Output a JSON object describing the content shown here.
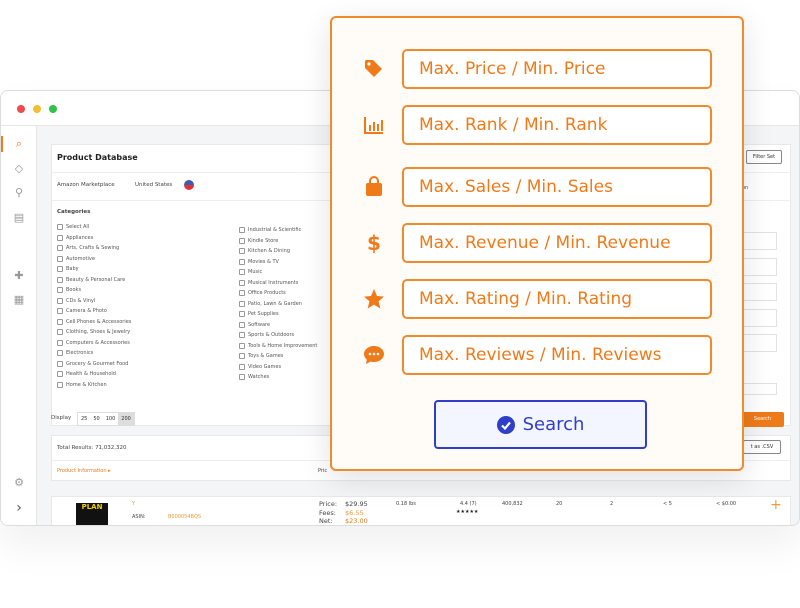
{
  "app": {
    "title": "Product Database",
    "marketplace_label": "Amazon Marketplace",
    "marketplace_value": "United States",
    "categories_label": "Categories",
    "save_filter": "Filter Set",
    "display_label": "Display",
    "display_options": [
      "25",
      "50",
      "100",
      "200"
    ],
    "total_results_label": "Total Results:",
    "total_results": "71,032,320",
    "col_product_info": "Product Information",
    "col_price": "Pric",
    "export": "t as .CSV",
    "search_small": "Search",
    "right_label": "on"
  },
  "categories_col1": [
    "Select All",
    "Appliances",
    "Arts, Crafts & Sewing",
    "Automotive",
    "Baby",
    "Beauty & Personal Care",
    "Books",
    "CDs & Vinyl",
    "Camera & Photo",
    "Cell Phones & Accessories",
    "Clothing, Shoes & Jewelry",
    "Computers & Accessories",
    "Electronics",
    "Grocery & Gourmet Food",
    "Health & Household",
    "Home & Kitchen"
  ],
  "categories_col2": [
    "Industrial & Scientific",
    "Kindle Store",
    "Kitchen & Dining",
    "Movies & TV",
    "Music",
    "Musical Instruments",
    "Office Products",
    "Patio, Lawn & Garden",
    "Pet Supplies",
    "Software",
    "Sports & Outdoors",
    "Tools & Home Improvement",
    "Toys & Games",
    "Video Games",
    "Watches"
  ],
  "row": {
    "title": "Y",
    "asin_label": "ASIN:",
    "asin": "B000054BQS",
    "price_label": "Price:",
    "price": "$29.95",
    "fees_label": "Fees:",
    "fees": "$6.55",
    "net_label": "Net:",
    "net": "$23.00",
    "weight": "0.18 lbs",
    "rating": "4.4 (7)",
    "rank": "400,832",
    "sales": "20",
    "sellers": "2",
    "reviews": "< 5",
    "revenue": "< $0.00"
  },
  "filters": [
    {
      "icon": "tag-icon",
      "label": "Max. Price / Min. Price"
    },
    {
      "icon": "bar-chart-icon",
      "label": "Max. Rank / Min. Rank"
    },
    {
      "icon": "shopping-bag-icon",
      "label": "Max. Sales / Min. Sales"
    },
    {
      "icon": "dollar-icon",
      "label": "Max. Revenue / Min. Revenue"
    },
    {
      "icon": "star-icon",
      "label": "Max. Rating / Min. Rating"
    },
    {
      "icon": "chat-icon",
      "label": "Max. Reviews / Min. Reviews"
    }
  ],
  "search_button": "Search",
  "colors": {
    "accent": "#ef7a1a",
    "search": "#2f3fc9"
  }
}
